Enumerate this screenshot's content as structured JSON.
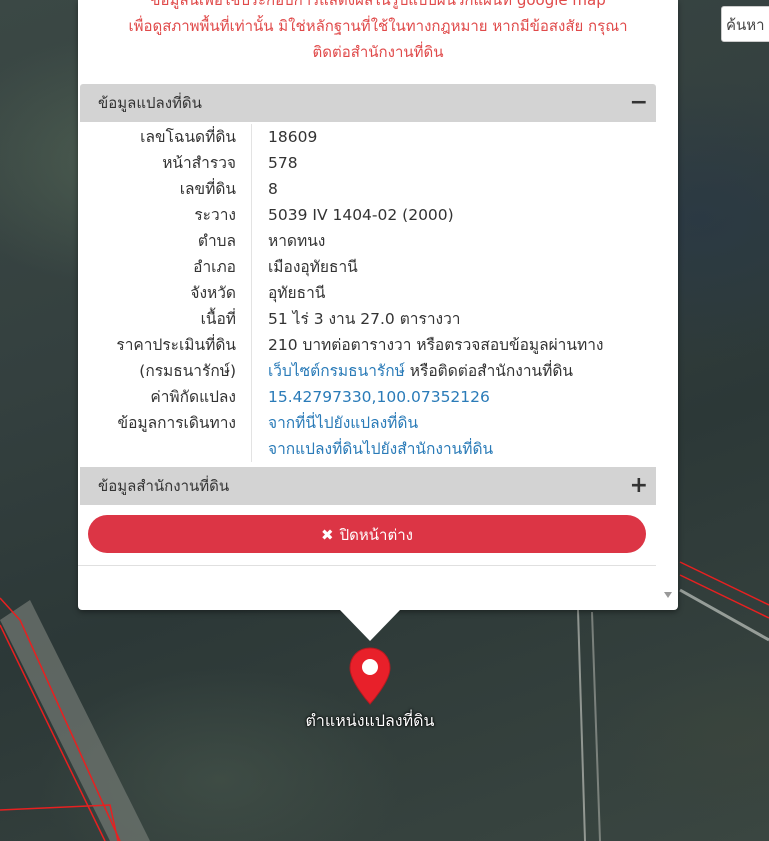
{
  "search": {
    "placeholder": "ค้นหา"
  },
  "disclaimer": {
    "line1": "ข้อมูลนี้เพื่อใช้ประกอบการแสดงผลในรูปแบบผนวกแผนที่ google map",
    "line2": "เพื่อดูสภาพพื้นที่เท่านั้น มิใช่หลักฐานที่ใช้ในทางกฎหมาย หากมีข้อสงสัย กรุณา",
    "line3": "ติดต่อสำนักงานที่ดิน"
  },
  "parcel_panel": {
    "title": "ข้อมูลแปลงที่ดิน",
    "toggle": "−",
    "rows": [
      {
        "label": "เลขโฉนดที่ดิน",
        "value": "18609"
      },
      {
        "label": "หน้าสำรวจ",
        "value": "578"
      },
      {
        "label": "เลขที่ดิน",
        "value": "8"
      },
      {
        "label": "ระวาง",
        "value": "5039 IV 1404-02 (2000)"
      },
      {
        "label": "ตำบล",
        "value": "หาดทนง"
      },
      {
        "label": "อำเภอ",
        "value": "เมืองอุทัยธานี"
      },
      {
        "label": "จังหวัด",
        "value": "อุทัยธานี"
      },
      {
        "label": "เนื้อที่",
        "value": "51 ไร่ 3 งาน 27.0 ตารางวา"
      }
    ],
    "price": {
      "label1": "ราคาประเมินที่ดิน",
      "label2": "(กรมธนารักษ์)",
      "value1": "210 บาทต่อตารางวา หรือตรวจสอบข้อมูลผ่านทาง",
      "link": "เว็บไซต์กรมธนารักษ์",
      "value2_rest": " หรือติดต่อสำนักงานที่ดิน"
    },
    "coords": {
      "label": "ค่าพิกัดแปลง",
      "value": "15.42797330,100.07352126"
    },
    "travel": {
      "label": "ข้อมูลการเดินทาง",
      "link1": "จากที่นี่ไปยังแปลงที่ดิน",
      "link2": "จากแปลงที่ดินไปยังสำนักงานที่ดิน"
    }
  },
  "office_panel": {
    "title": "ข้อมูลสำนักงานที่ดิน",
    "toggle": "+"
  },
  "close_button": {
    "icon": "✖",
    "label": "ปิดหน้าต่าง"
  },
  "marker": {
    "label": "ตำแหน่งแปลงที่ดิน",
    "color": "#e8202a"
  },
  "colors": {
    "accent_red": "#dc3545",
    "link_blue": "#2a7bb8",
    "disclaimer_red": "#e04a4a"
  }
}
